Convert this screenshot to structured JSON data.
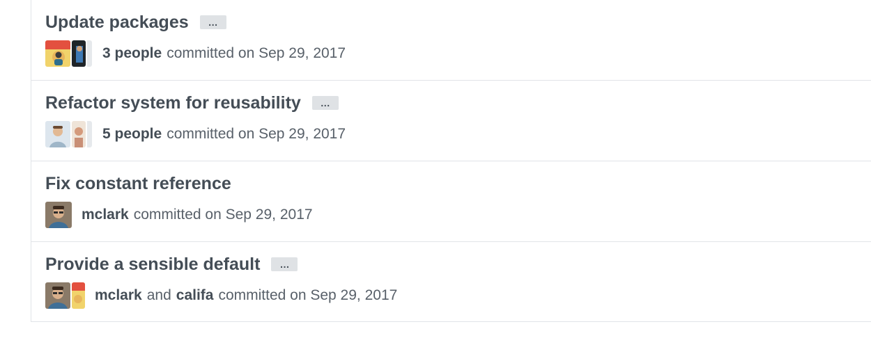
{
  "commits": [
    {
      "title": "Update packages",
      "has_ellipsis": true,
      "ellipsis": "…",
      "authors_label": "3 people",
      "committed_text": "committed on Sep 29, 2017"
    },
    {
      "title": "Refactor system for reusability",
      "has_ellipsis": true,
      "ellipsis": "…",
      "authors_label": "5 people",
      "committed_text": "committed on Sep 29, 2017"
    },
    {
      "title": "Fix constant reference",
      "has_ellipsis": false,
      "authors_label": "mclark",
      "committed_text": "committed on Sep 29, 2017"
    },
    {
      "title": "Provide a sensible default",
      "has_ellipsis": true,
      "ellipsis": "…",
      "author_1": "mclark",
      "and_text": "and",
      "author_2": "califa",
      "committed_text": "committed on Sep 29, 2017"
    }
  ]
}
